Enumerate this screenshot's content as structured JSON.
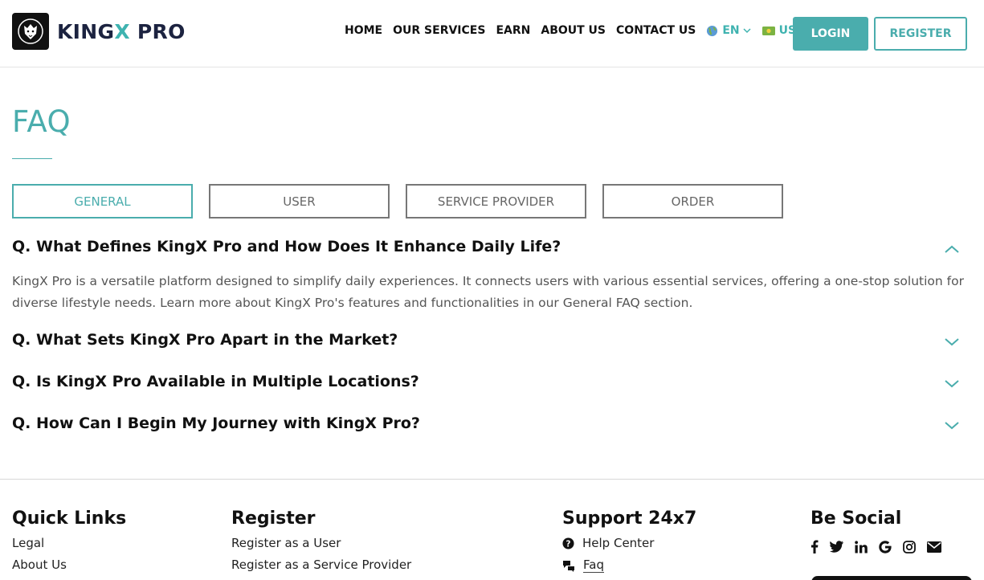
{
  "header": {
    "logo_text_a": "KING",
    "logo_text_x": "X",
    "logo_text_b": " PRO",
    "nav": [
      "HOME",
      "OUR SERVICES",
      "EARN",
      "ABOUT US",
      "CONTACT US"
    ],
    "language": "EN",
    "currency": "USD",
    "login_label": "LOGIN",
    "register_label": "REGISTER"
  },
  "faq": {
    "title": "FAQ",
    "tabs": [
      "GENERAL",
      "USER",
      "SERVICE PROVIDER",
      "ORDER"
    ],
    "active_tab": "GENERAL",
    "questions": [
      {
        "q": "Q.  What Defines KingX Pro and How Does It Enhance Daily Life?",
        "answer": "KingX Pro is a versatile platform designed to simplify daily experiences. It connects users with various essential services, offering a one-stop solution for diverse lifestyle needs. Learn more about KingX Pro's features and functionalities in our General FAQ section.",
        "expanded": true
      },
      {
        "q": "Q.  What Sets KingX Pro Apart in the Market?",
        "expanded": false
      },
      {
        "q": "Q.  Is KingX Pro Available in Multiple Locations?",
        "expanded": false
      },
      {
        "q": "Q.  How Can I Begin My Journey with KingX Pro?",
        "expanded": false
      }
    ]
  },
  "footer": {
    "quick_links": {
      "title": "Quick Links",
      "items": [
        "Legal",
        "About Us"
      ]
    },
    "register": {
      "title": "Register",
      "items": [
        "Register as a User",
        "Register as a Service Provider"
      ]
    },
    "support": {
      "title": "Support 24x7",
      "items": [
        "Help Center",
        "Faq"
      ]
    },
    "social": {
      "title": "Be Social",
      "icons": [
        "facebook-icon",
        "twitter-icon",
        "linkedin-icon",
        "google-icon",
        "instagram-icon",
        "email-icon"
      ]
    }
  },
  "colors": {
    "accent": "#4aadad",
    "dark": "#1c2340"
  }
}
